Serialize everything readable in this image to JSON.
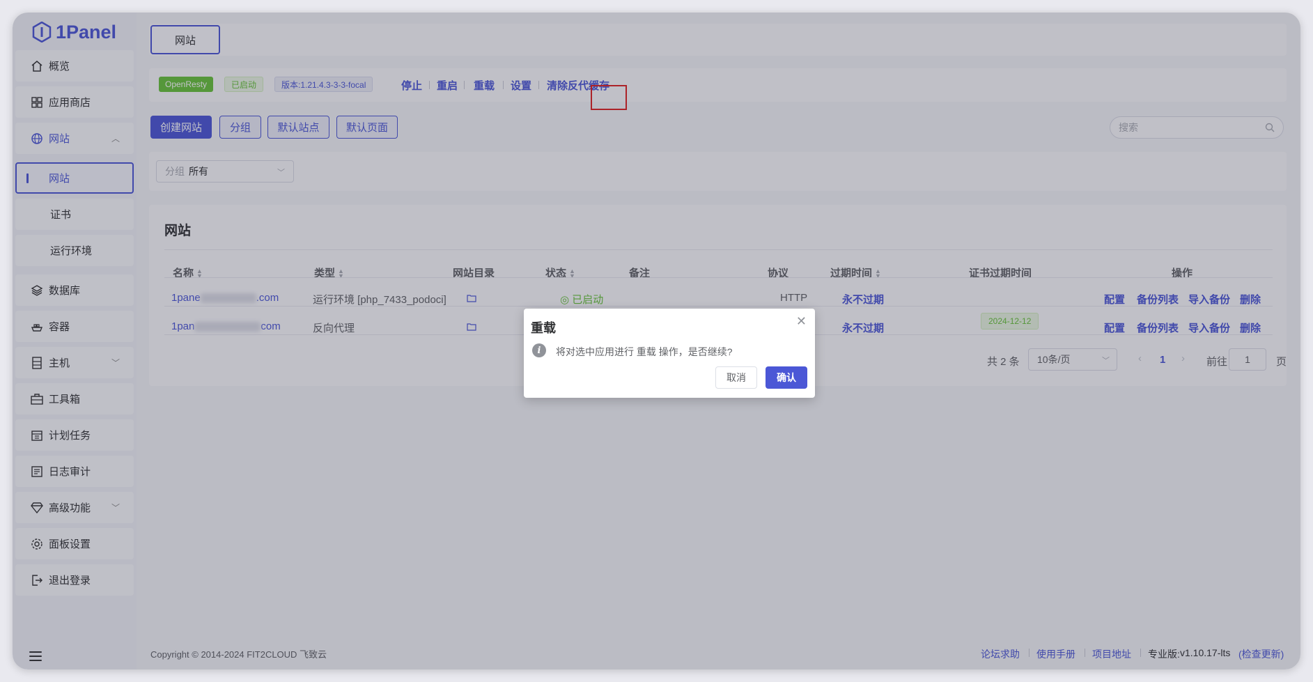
{
  "app": {
    "logo_text": "1Panel"
  },
  "sidebar": {
    "items": [
      {
        "label": "概览",
        "icon": "home-icon"
      },
      {
        "label": "应用商店",
        "icon": "grid-icon"
      },
      {
        "label": "网站",
        "icon": "globe-icon"
      },
      {
        "label": "网站"
      },
      {
        "label": "证书"
      },
      {
        "label": "运行环境"
      },
      {
        "label": "数据库",
        "icon": "layers-icon"
      },
      {
        "label": "容器",
        "icon": "ship-icon"
      },
      {
        "label": "主机",
        "icon": "server-icon"
      },
      {
        "label": "工具箱",
        "icon": "toolbox-icon"
      },
      {
        "label": "计划任务",
        "icon": "calendar-icon"
      },
      {
        "label": "日志审计",
        "icon": "log-icon"
      },
      {
        "label": "高级功能",
        "icon": "diamond-icon"
      },
      {
        "label": "面板设置",
        "icon": "gear-icon"
      },
      {
        "label": "退出登录",
        "icon": "logout-icon"
      }
    ]
  },
  "header": {
    "tab_label": "网站"
  },
  "app_status": {
    "name_tag": "OpenResty",
    "status_tag": "已启动",
    "version_tag": "版本:1.21.4.3-3-3-focal",
    "actions": [
      "停止",
      "重启",
      "重载",
      "设置",
      "清除反代缓存"
    ]
  },
  "toolbar": {
    "create": "创建网站",
    "group": "分组",
    "default_site": "默认站点",
    "default_page": "默认页面",
    "search_placeholder": "搜索"
  },
  "filter": {
    "prefix": "分组",
    "value": "所有"
  },
  "table": {
    "title": "网站",
    "headers": [
      "名称",
      "类型",
      "网站目录",
      "状态",
      "备注",
      "协议",
      "过期时间",
      "证书过期时间",
      "操作"
    ],
    "rows": [
      {
        "name_start": "1pane",
        "name_end": ".com",
        "type": "运行环境 [php_7433_podoci]",
        "status": "已启动",
        "protocol": "HTTP",
        "expire": "永不过期",
        "cert_expire": "",
        "actions": [
          "配置",
          "备份列表",
          "导入备份",
          "删除"
        ]
      },
      {
        "name_start": "1pan",
        "name_end": "com",
        "type": "反向代理",
        "status": "",
        "protocol": "",
        "expire": "永不过期",
        "cert_expire": "2024-12-12",
        "actions": [
          "配置",
          "备份列表",
          "导入备份",
          "删除"
        ]
      }
    ]
  },
  "pagination": {
    "total": "共 2 条",
    "page_size": "10条/页",
    "current": "1",
    "goto_label": "前往",
    "goto_value": "1",
    "page_suffix": "页"
  },
  "footer": {
    "copyright": "Copyright © 2014-2024 FIT2CLOUD 飞致云",
    "links": [
      "论坛求助",
      "使用手册",
      "项目地址"
    ],
    "edition_label": "专业版:",
    "version": "v1.10.17-lts",
    "check_update": "(检查更新)"
  },
  "dialog": {
    "title": "重载",
    "message": "将对选中应用进行 重载 操作，是否继续?",
    "cancel": "取消",
    "confirm": "确认"
  },
  "colors": {
    "accent": "#4b57d6",
    "success": "#67c23a",
    "highlight": "#e02020"
  }
}
